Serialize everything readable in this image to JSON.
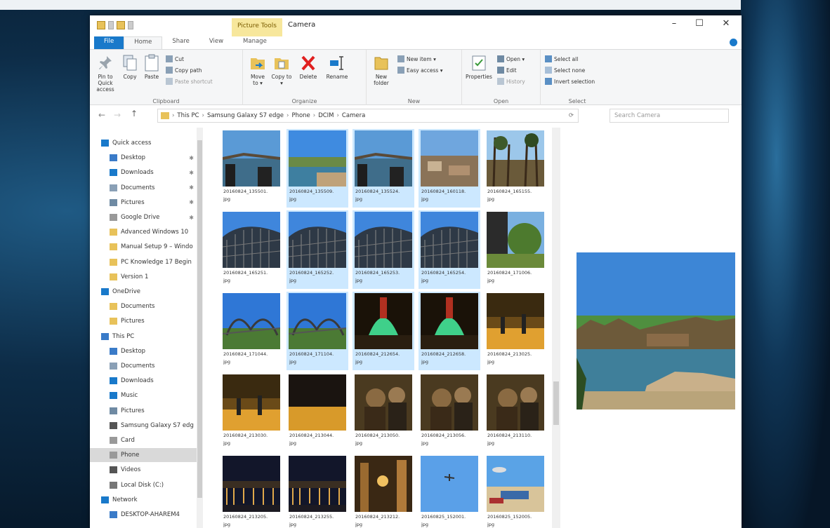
{
  "window": {
    "title": "Camera",
    "context_tab": "Picture Tools",
    "ctrl_min": "–",
    "ctrl_max": "☐",
    "ctrl_close": "✕"
  },
  "tabs": [
    "File",
    "Home",
    "Share",
    "View",
    "Manage"
  ],
  "ribbon": {
    "clipboard": {
      "name": "Clipboard",
      "pin": "Pin to Quick access",
      "copy": "Copy",
      "paste": "Paste",
      "cut": "Cut",
      "copy_path": "Copy path",
      "paste_shortcut": "Paste shortcut"
    },
    "organize": {
      "name": "Organize",
      "move_to": "Move to ▾",
      "copy_to": "Copy to ▾",
      "delete": "Delete",
      "rename": "Rename"
    },
    "new": {
      "name": "New",
      "new_folder": "New folder",
      "new_item": "New item ▾",
      "easy_access": "Easy access ▾"
    },
    "open": {
      "name": "Open",
      "properties": "Properties",
      "open": "Open ▾",
      "edit": "Edit",
      "history": "History"
    },
    "select": {
      "name": "Select",
      "select_all": "Select all",
      "select_none": "Select none",
      "invert": "Invert selection"
    }
  },
  "address": {
    "back": "←",
    "forward": "→",
    "up_arrow": "↑",
    "crumbs": [
      "This PC",
      "Samsung Galaxy S7 edge",
      "Phone",
      "DCIM",
      "Camera"
    ],
    "refresh": "⟳",
    "search_placeholder": "Search Camera"
  },
  "nav": [
    {
      "label": "Quick access",
      "icon": "star-icon",
      "pin": false
    },
    {
      "label": "Desktop",
      "icon": "desktop-icon",
      "pin": true
    },
    {
      "label": "Downloads",
      "icon": "download-icon",
      "pin": true
    },
    {
      "label": "Documents",
      "icon": "documents-icon",
      "pin": true
    },
    {
      "label": "Pictures",
      "icon": "pictures-icon",
      "pin": true
    },
    {
      "label": "Google Drive",
      "icon": "drive-icon",
      "pin": true
    },
    {
      "label": "Advanced Windows 10",
      "icon": "folder-icon",
      "pin": false
    },
    {
      "label": "Manual Setup 9 – Windo",
      "icon": "folder-icon",
      "pin": false
    },
    {
      "label": "PC Knowledge 17 Begin",
      "icon": "folder-icon",
      "pin": false
    },
    {
      "label": "Version 1",
      "icon": "folder-icon",
      "pin": false
    },
    {
      "label": "OneDrive",
      "icon": "cloud-icon",
      "pin": false
    },
    {
      "label": "Documents",
      "icon": "folder-icon",
      "pin": false
    },
    {
      "label": "Pictures",
      "icon": "folder-icon",
      "pin": false
    },
    {
      "label": "This PC",
      "icon": "pc-icon",
      "pin": false
    },
    {
      "label": "Desktop",
      "icon": "desktop-icon",
      "pin": false
    },
    {
      "label": "Documents",
      "icon": "documents-icon",
      "pin": false
    },
    {
      "label": "Downloads",
      "icon": "download-icon",
      "pin": false
    },
    {
      "label": "Music",
      "icon": "music-icon",
      "pin": false
    },
    {
      "label": "Pictures",
      "icon": "pictures-icon",
      "pin": false
    },
    {
      "label": "Samsung Galaxy S7 edg",
      "icon": "phone-icon",
      "pin": false
    },
    {
      "label": "Card",
      "icon": "drive-icon",
      "pin": false
    },
    {
      "label": "Phone",
      "icon": "drive-icon",
      "pin": false,
      "selected": true
    },
    {
      "label": "Videos",
      "icon": "video-icon",
      "pin": false
    },
    {
      "label": "Local Disk (C:)",
      "icon": "disk-icon",
      "pin": false
    },
    {
      "label": "Network",
      "icon": "network-icon",
      "pin": false
    },
    {
      "label": "DESKTOP-AHAREM4",
      "icon": "pc-icon",
      "pin": false
    }
  ],
  "files": [
    {
      "name": "20160824_135501.",
      "ext": "jpg",
      "sel": false,
      "t": "coaster"
    },
    {
      "name": "20160824_135509.",
      "ext": "jpg",
      "sel": true,
      "t": "lake"
    },
    {
      "name": "20160824_135524.",
      "ext": "jpg",
      "sel": true,
      "t": "coaster"
    },
    {
      "name": "20160824_160118.",
      "ext": "jpg",
      "sel": true,
      "t": "town"
    },
    {
      "name": "20160824_165155.",
      "ext": "jpg",
      "sel": false,
      "t": "trees"
    },
    {
      "name": "20160824_165251.",
      "ext": "jpg",
      "sel": false,
      "t": "wood"
    },
    {
      "name": "20160824_165252.",
      "ext": "jpg",
      "sel": true,
      "t": "wood"
    },
    {
      "name": "20160824_165253.",
      "ext": "jpg",
      "sel": true,
      "t": "wood"
    },
    {
      "name": "20160824_165254.",
      "ext": "jpg",
      "sel": true,
      "t": "wood"
    },
    {
      "name": "20160824_171006.",
      "ext": "jpg",
      "sel": false,
      "t": "garden"
    },
    {
      "name": "20160824_171044.",
      "ext": "jpg",
      "sel": false,
      "t": "loop"
    },
    {
      "name": "20160824_171104.",
      "ext": "jpg",
      "sel": true,
      "t": "loop"
    },
    {
      "name": "20160824_212654.",
      "ext": "jpg",
      "sel": true,
      "t": "fountain"
    },
    {
      "name": "20160824_212658.",
      "ext": "jpg",
      "sel": true,
      "t": "fountain"
    },
    {
      "name": "20160824_213025.",
      "ext": "jpg",
      "sel": false,
      "t": "night"
    },
    {
      "name": "20160824_213030.",
      "ext": "jpg",
      "sel": false,
      "t": "night"
    },
    {
      "name": "20160824_213044.",
      "ext": "jpg",
      "sel": false,
      "t": "nightdark"
    },
    {
      "name": "20160824_213050.",
      "ext": "jpg",
      "sel": false,
      "t": "crowd"
    },
    {
      "name": "20160824_213056.",
      "ext": "jpg",
      "sel": false,
      "t": "crowd"
    },
    {
      "name": "20160824_213110.",
      "ext": "jpg",
      "sel": false,
      "t": "crowd"
    },
    {
      "name": "20160824_213205.",
      "ext": "jpg",
      "sel": false,
      "t": "harbor"
    },
    {
      "name": "20160824_213255.",
      "ext": "jpg",
      "sel": false,
      "t": "harbor"
    },
    {
      "name": "20160824_213212.",
      "ext": "jpg",
      "sel": false,
      "t": "street"
    },
    {
      "name": "20160825_152001.",
      "ext": "jpg",
      "sel": false,
      "t": "sky"
    },
    {
      "name": "20160825_152005.",
      "ext": "jpg",
      "sel": false,
      "t": "beach"
    }
  ],
  "colors": {
    "accent": "#1979ca",
    "selection": "#cce8ff",
    "folder": "#e8c25a"
  }
}
